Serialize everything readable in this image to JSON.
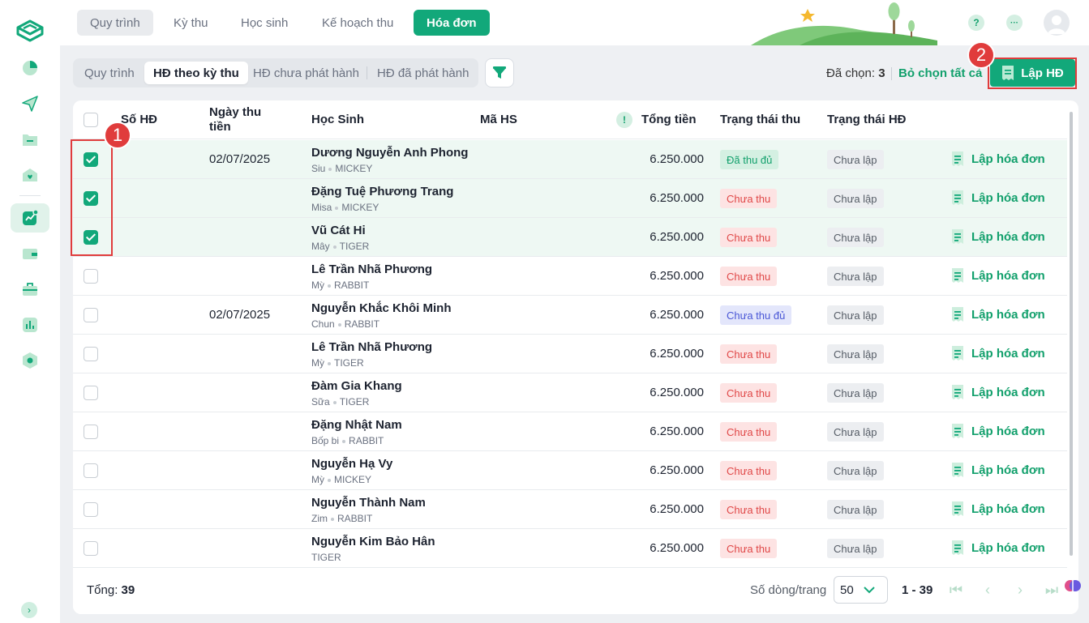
{
  "top_tabs": [
    "Quy trình",
    "Kỳ thu",
    "Học sinh",
    "Kế hoạch thu",
    "Hóa đơn"
  ],
  "header_icons": {
    "help": "?",
    "more": "···"
  },
  "sub_tabs": [
    "Quy trình",
    "HĐ theo kỳ thu",
    "HĐ chưa phát hành",
    "HĐ đã phát hành"
  ],
  "selection": {
    "label": "Đã chọn:",
    "count": "3",
    "deselect_all": "Bỏ chọn tất cả"
  },
  "create_button": "Lập HĐ",
  "annotations": {
    "one": "1",
    "two": "2"
  },
  "columns": {
    "invoice_no": "Số HĐ",
    "collect_date": "Ngày thu tiền",
    "student": "Học Sinh",
    "student_id": "Mã HS",
    "total": "Tổng tiền",
    "collect_status": "Trạng thái thu",
    "invoice_status": "Trạng thái HĐ"
  },
  "rows": [
    {
      "checked": true,
      "date": "02/07/2025",
      "name": "Dương Nguyễn Anh Phong",
      "nick": "Siu",
      "class": "MICKEY",
      "amount": "6.250.000",
      "status": "Đã thu đủ",
      "status_type": "green",
      "hd": "Chưa lập",
      "action": "Lập hóa đơn"
    },
    {
      "checked": true,
      "date": "",
      "name": "Đặng Tuệ Phương Trang",
      "nick": "Misa",
      "class": "MICKEY",
      "amount": "6.250.000",
      "status": "Chưa thu",
      "status_type": "red",
      "hd": "Chưa lập",
      "action": "Lập hóa đơn"
    },
    {
      "checked": true,
      "date": "",
      "name": "Vũ Cát Hi",
      "nick": "Mây",
      "class": "TIGER",
      "amount": "6.250.000",
      "status": "Chưa thu",
      "status_type": "red",
      "hd": "Chưa lập",
      "action": "Lập hóa đơn"
    },
    {
      "checked": false,
      "date": "",
      "name": "Lê Trần Nhã Phương",
      "nick": "Mỳ",
      "class": "RABBIT",
      "amount": "6.250.000",
      "status": "Chưa thu",
      "status_type": "red",
      "hd": "Chưa lập",
      "action": "Lập hóa đơn"
    },
    {
      "checked": false,
      "date": "02/07/2025",
      "name": "Nguyễn Khắc Khôi Minh",
      "nick": "Chun",
      "class": "RABBIT",
      "amount": "6.250.000",
      "status": "Chưa thu đủ",
      "status_type": "blue",
      "hd": "Chưa lập",
      "action": "Lập hóa đơn"
    },
    {
      "checked": false,
      "date": "",
      "name": "Lê Trần Nhã Phương",
      "nick": "Mỳ",
      "class": "TIGER",
      "amount": "6.250.000",
      "status": "Chưa thu",
      "status_type": "red",
      "hd": "Chưa lập",
      "action": "Lập hóa đơn"
    },
    {
      "checked": false,
      "date": "",
      "name": "Đàm Gia Khang",
      "nick": "Sữa",
      "class": "TIGER",
      "amount": "6.250.000",
      "status": "Chưa thu",
      "status_type": "red",
      "hd": "Chưa lập",
      "action": "Lập hóa đơn"
    },
    {
      "checked": false,
      "date": "",
      "name": "Đặng Nhật Nam",
      "nick": "Bốp bi",
      "class": "RABBIT",
      "amount": "6.250.000",
      "status": "Chưa thu",
      "status_type": "red",
      "hd": "Chưa lập",
      "action": "Lập hóa đơn"
    },
    {
      "checked": false,
      "date": "",
      "name": "Nguyễn Hạ Vy",
      "nick": "Mỳ",
      "class": "MICKEY",
      "amount": "6.250.000",
      "status": "Chưa thu",
      "status_type": "red",
      "hd": "Chưa lập",
      "action": "Lập hóa đơn"
    },
    {
      "checked": false,
      "date": "",
      "name": "Nguyễn Thành Nam",
      "nick": "Zim",
      "class": "RABBIT",
      "amount": "6.250.000",
      "status": "Chưa thu",
      "status_type": "red",
      "hd": "Chưa lập",
      "action": "Lập hóa đơn"
    },
    {
      "checked": false,
      "date": "",
      "name": "Nguyễn Kim Bảo Hân",
      "nick": "",
      "class": "TIGER",
      "amount": "6.250.000",
      "status": "Chưa thu",
      "status_type": "red",
      "hd": "Chưa lập",
      "action": "Lập hóa đơn"
    }
  ],
  "footer": {
    "total_label": "Tổng:",
    "total_value": "39",
    "per_page_label": "Số dòng/trang",
    "per_page": "50",
    "range": "1 - 39"
  },
  "icons": {
    "sidebar": [
      "pie-chart-icon",
      "send-icon",
      "folder-icon",
      "heart-home-icon",
      "trend-chart-icon",
      "wallet-icon",
      "briefcase-icon",
      "bar-chart-icon",
      "settings-icon"
    ],
    "pagination": [
      "first-page-icon",
      "prev-page-icon",
      "next-page-icon",
      "last-page-icon"
    ]
  },
  "colors": {
    "accent": "#12a87a",
    "highlight": "#e03c3c",
    "status_red": "#e04848",
    "status_blue": "#4a57d6"
  }
}
